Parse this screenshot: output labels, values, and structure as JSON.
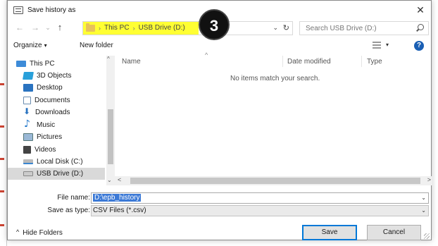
{
  "window": {
    "title": "Save history as",
    "close_symbol": "✕"
  },
  "navigation": {
    "back_symbol": "←",
    "forward_symbol": "→",
    "recent_symbol": "⌄",
    "up_symbol": "↑",
    "breadcrumb": [
      "This PC",
      "USB Drive (D:)"
    ],
    "breadcrumb_separator": "›",
    "highlight_color": "#ffff33",
    "refresh_symbol": "↻",
    "dropdown_symbol": "⌄",
    "search_placeholder": "Search USB Drive (D:)"
  },
  "annotation_badge": "3",
  "toolbar": {
    "organize_label": "Organize",
    "organize_caret": "▾",
    "new_folder_label": "New folder",
    "view_caret": "▾",
    "help_symbol": "?"
  },
  "sidebar": {
    "items": [
      {
        "label": "This PC",
        "icon": "computer-icon"
      },
      {
        "label": "3D Objects",
        "icon": "3d-objects-icon"
      },
      {
        "label": "Desktop",
        "icon": "desktop-icon"
      },
      {
        "label": "Documents",
        "icon": "documents-icon"
      },
      {
        "label": "Downloads",
        "icon": "downloads-icon"
      },
      {
        "label": "Music",
        "icon": "music-icon"
      },
      {
        "label": "Pictures",
        "icon": "pictures-icon"
      },
      {
        "label": "Videos",
        "icon": "videos-icon"
      },
      {
        "label": "Local Disk (C:)",
        "icon": "local-disk-icon"
      },
      {
        "label": "USB Drive (D:)",
        "icon": "usb-drive-icon",
        "selected": true
      }
    ]
  },
  "file_list": {
    "sort_indicator": "^",
    "columns": [
      "Name",
      "Date modified",
      "Type"
    ],
    "empty_message": "No items match your search."
  },
  "scroll": {
    "up_arrow": "^",
    "down_arrow": "⌄",
    "left_arrow": "<",
    "right_arrow": ">"
  },
  "form": {
    "file_name_label": "File name:",
    "file_name_value": "D:\\epb_history",
    "save_as_type_label": "Save as type:",
    "save_as_type_value": "CSV Files (*.csv)",
    "dropdown_caret": "⌄"
  },
  "footer": {
    "hide_folders_chevron": "^",
    "hide_folders_label": "Hide Folders",
    "save_label": "Save",
    "cancel_label": "Cancel"
  },
  "colors": {
    "selection": "#3b79d6",
    "help_icon": "#1a5fb4",
    "primary_button_border": "#0078d7"
  }
}
